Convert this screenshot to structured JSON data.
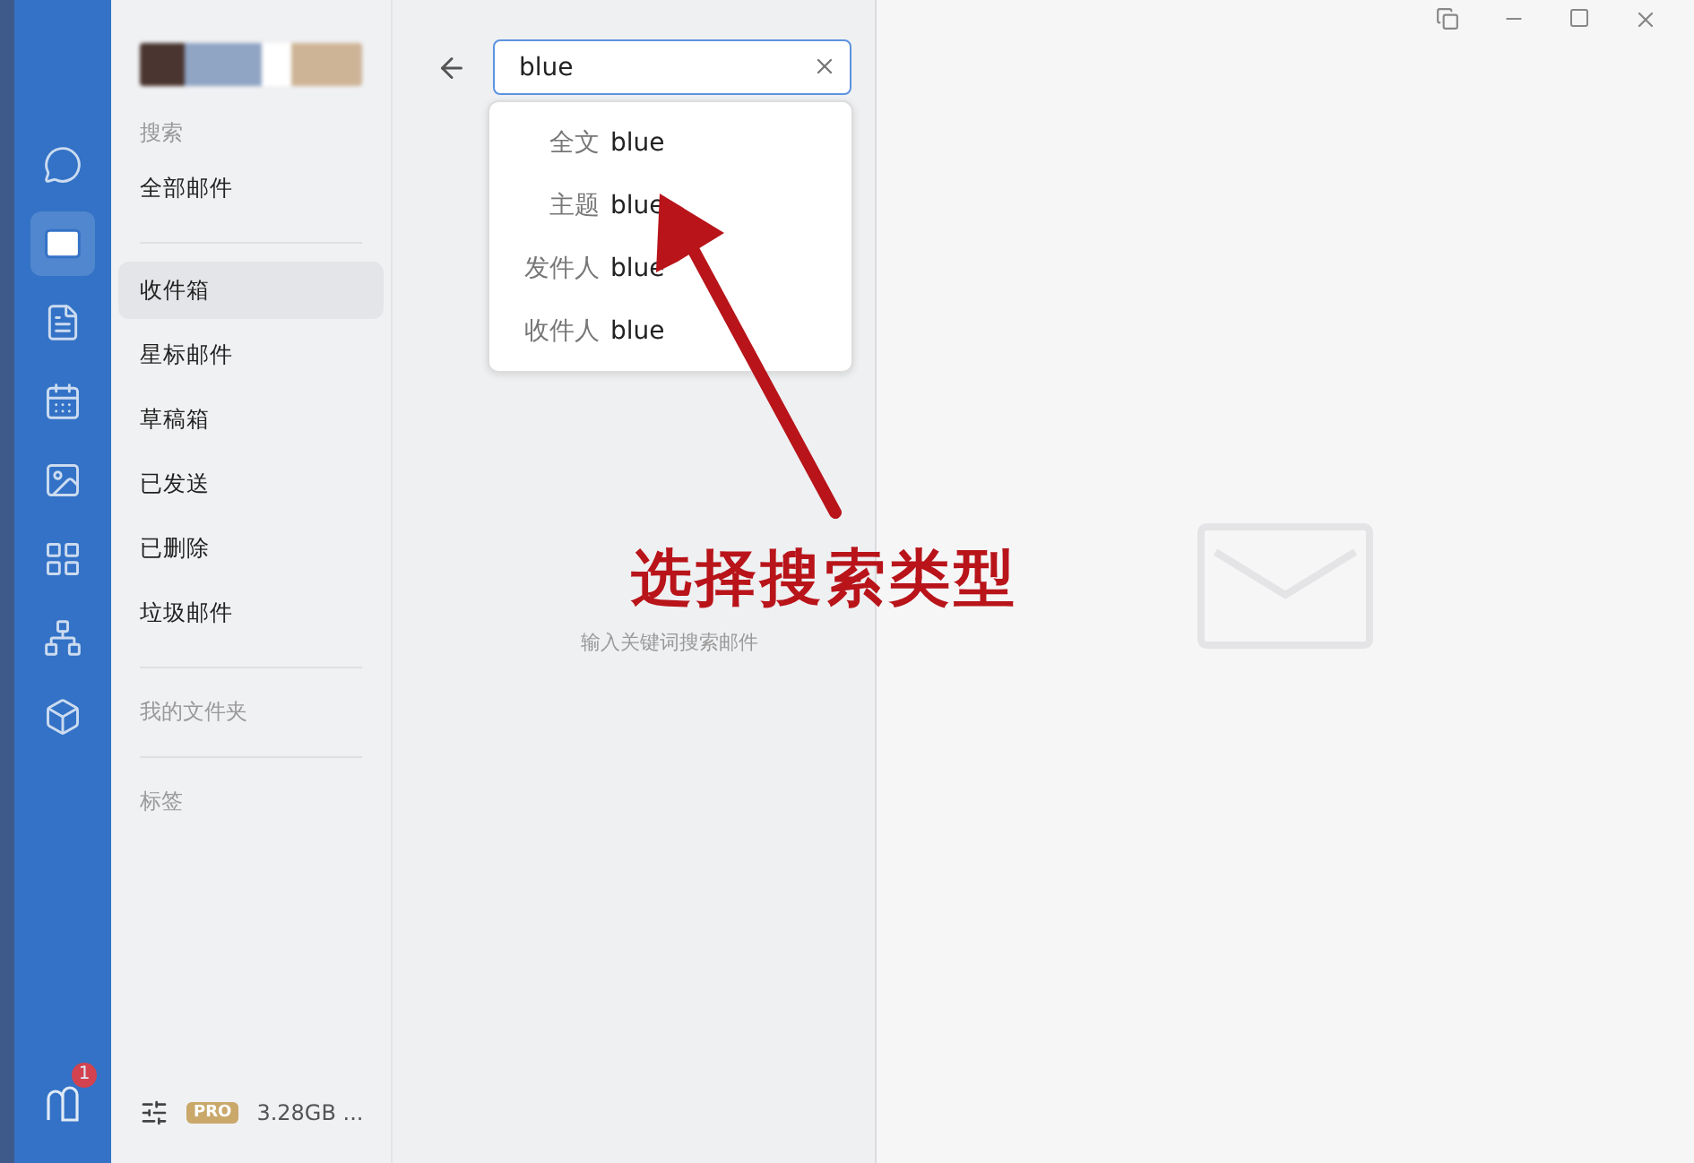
{
  "rail": {
    "items": [
      {
        "kind": "chat",
        "selected": false
      },
      {
        "kind": "mail",
        "selected": true
      },
      {
        "kind": "docs",
        "selected": false
      },
      {
        "kind": "calendar",
        "selected": false
      },
      {
        "kind": "photos",
        "selected": false
      },
      {
        "kind": "apps",
        "selected": false
      },
      {
        "kind": "org",
        "selected": false
      },
      {
        "kind": "cube",
        "selected": false
      }
    ],
    "notice_badge": "1"
  },
  "folders": {
    "search_label": "搜索",
    "all_mail": "全部邮件",
    "items": [
      {
        "label": "收件箱",
        "selected": true
      },
      {
        "label": "星标邮件",
        "selected": false
      },
      {
        "label": "草稿箱",
        "selected": false
      },
      {
        "label": "已发送",
        "selected": false
      },
      {
        "label": "已删除",
        "selected": false
      },
      {
        "label": "垃圾邮件",
        "selected": false
      }
    ],
    "my_folders": "我的文件夹",
    "tags": "标签",
    "plan_badge": "PRO",
    "storage": "3.28GB ..."
  },
  "search": {
    "value": "blue",
    "hint": "输入关键词搜索邮件",
    "suggestions": [
      {
        "label": "全文",
        "term": "blue"
      },
      {
        "label": "主题",
        "term": "blue"
      },
      {
        "label": "发件人",
        "term": "blue"
      },
      {
        "label": "收件人",
        "term": "blue"
      }
    ]
  },
  "annotation": {
    "text": "选择搜索类型"
  }
}
